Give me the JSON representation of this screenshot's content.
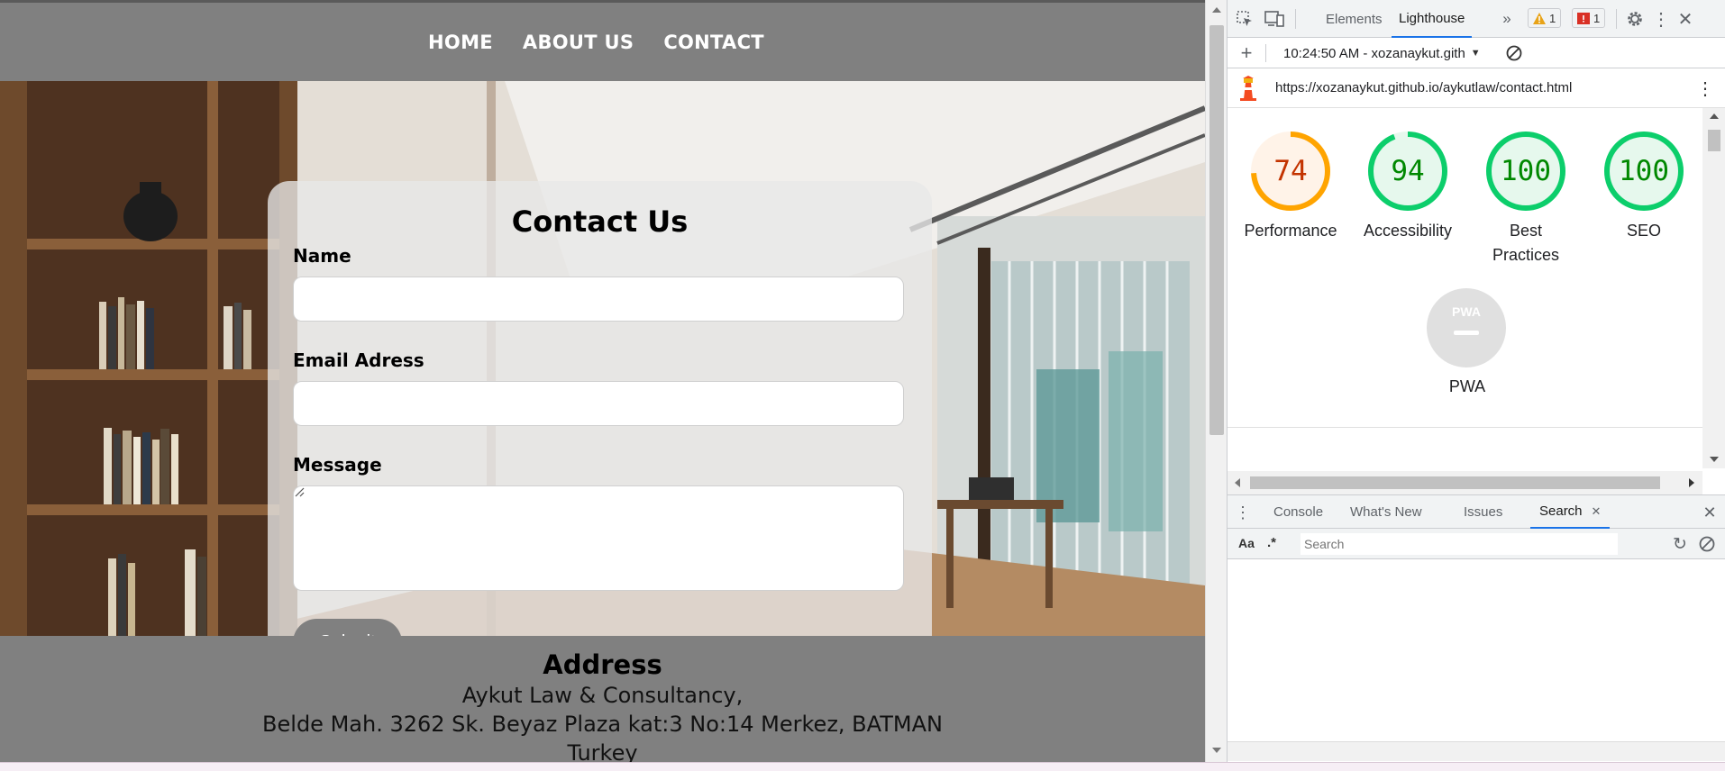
{
  "site": {
    "nav": [
      "HOME",
      "ABOUT US",
      "CONTACT"
    ],
    "form": {
      "title": "Contact Us",
      "name_label": "Name",
      "email_label": "Email Adress",
      "message_label": "Message",
      "submit_label": "Submit"
    },
    "address": {
      "heading": "Address",
      "line1": "Aykut Law & Consultancy,",
      "line2": "Belde Mah. 3262 Sk. Beyaz Plaza kat:3 No:14 Merkez, BATMAN",
      "line3": "Turkey"
    }
  },
  "devtools": {
    "tabs": [
      "Elements",
      "Lighthouse"
    ],
    "active_tab": "Lighthouse",
    "warnings_count": "1",
    "errors_count": "1",
    "report_selector": "10:24:50 AM - xozanaykut.gith",
    "report_url": "https://xozanaykut.github.io/aykutlaw/contact.html",
    "scores": [
      {
        "label": "Performance",
        "value": "74",
        "color": "#c33300",
        "ring": "#ffa400",
        "bg": "#fff3e8",
        "fraction": 0.74
      },
      {
        "label": "Accessibility",
        "value": "94",
        "color": "#008800",
        "ring": "#0cce6b",
        "bg": "#e6f8ed",
        "fraction": 0.94
      },
      {
        "label": "Best Practices",
        "value": "100",
        "color": "#008800",
        "ring": "#0cce6b",
        "bg": "#e6f8ed",
        "fraction": 1.0
      },
      {
        "label": "SEO",
        "value": "100",
        "color": "#008800",
        "ring": "#0cce6b",
        "bg": "#e6f8ed",
        "fraction": 1.0
      }
    ],
    "pwa": {
      "label": "PWA",
      "badge": "PWA"
    },
    "drawer_tabs": [
      "Console",
      "What's New",
      "Issues",
      "Search"
    ],
    "drawer_active": "Search",
    "search": {
      "case_label": "Aa",
      "regex_label": ".*",
      "placeholder": "Search"
    }
  }
}
